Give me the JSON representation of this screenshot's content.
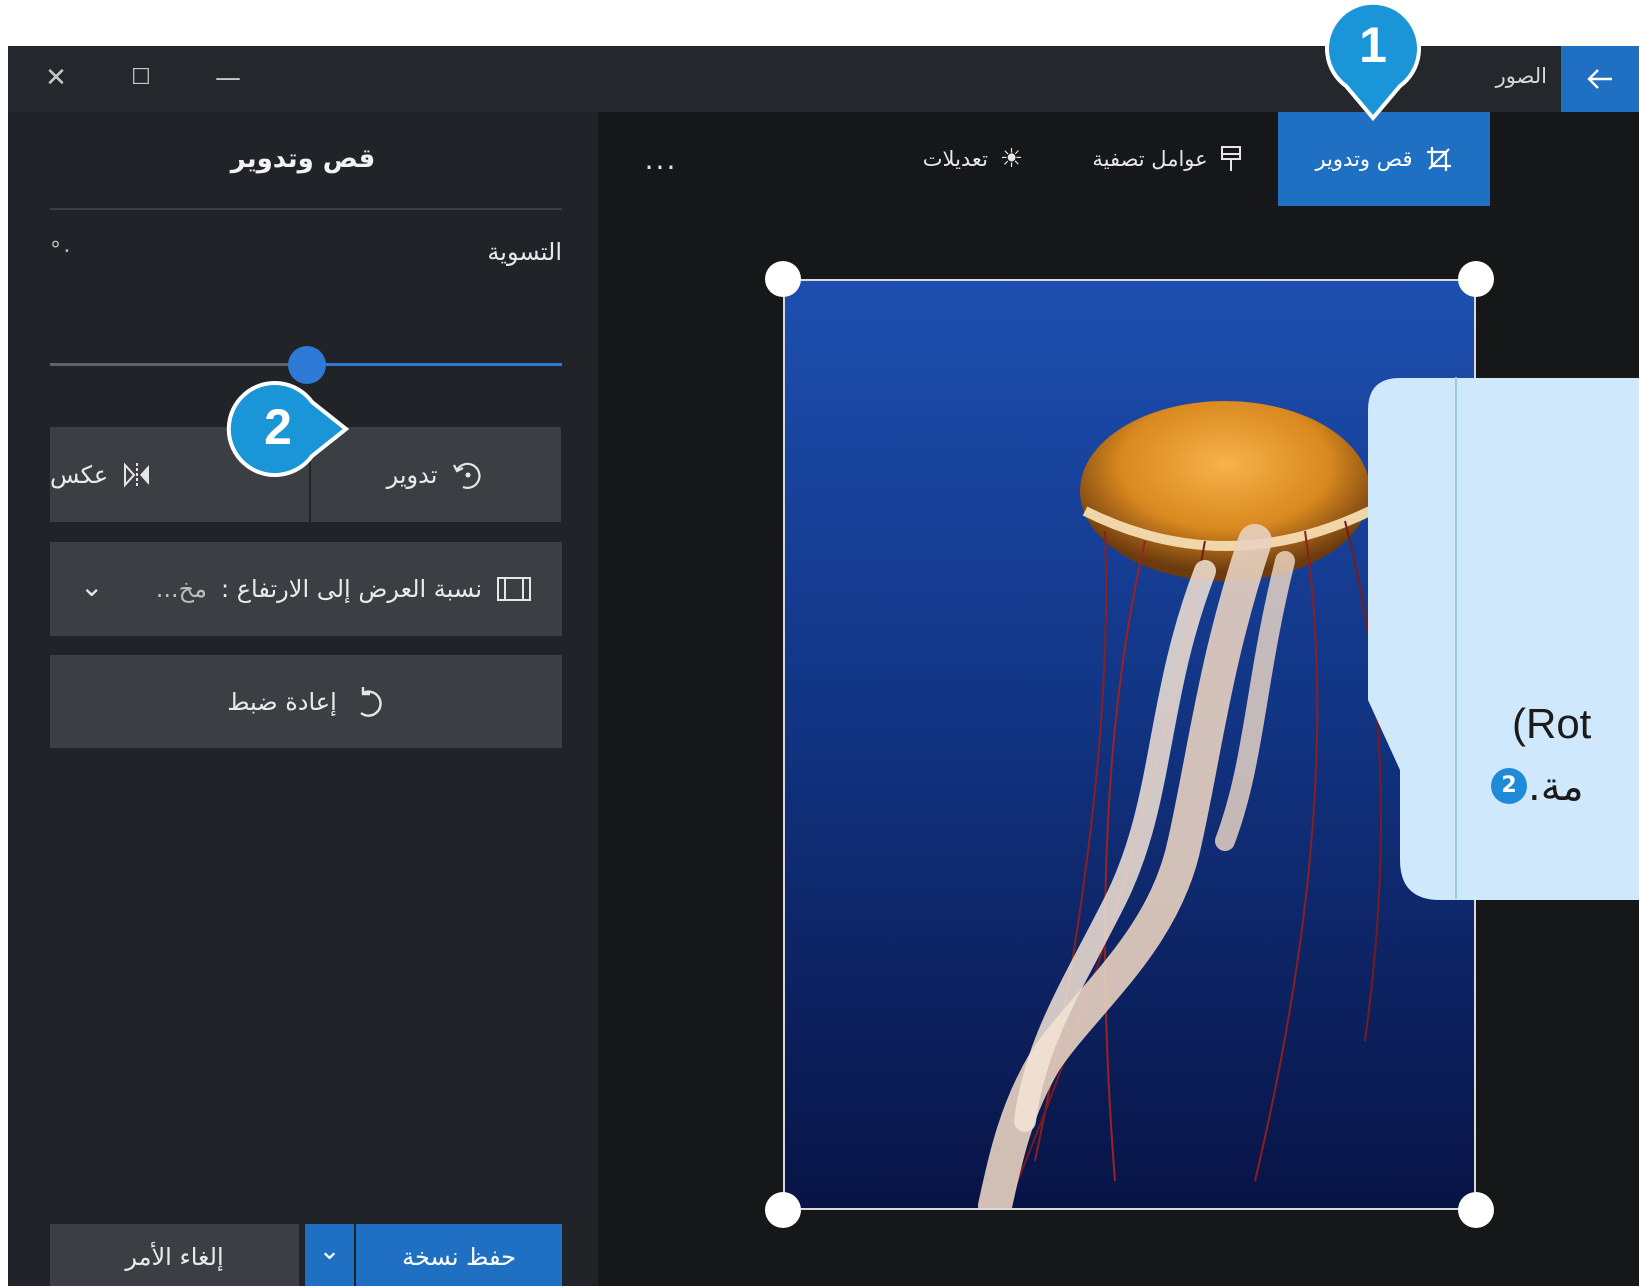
{
  "window": {
    "app_title": "الصور",
    "back_icon": "arrow-left-icon",
    "controls": {
      "close": "✕",
      "maximize": "☐",
      "minimize": "—"
    }
  },
  "toolbar": {
    "crop_rotate": "قص وتدوير",
    "filters": "عوامل تصفية",
    "adjustments": "تعديلات",
    "more": "..."
  },
  "panel": {
    "title": "قص وتدوير",
    "straighten_label": "التسوية",
    "straighten_value": "°٠",
    "straighten_level": 0.5,
    "rotate": "تدوير",
    "flip": "عكس",
    "aspect_ratio_label": "نسبة العرض إلى الارتفاع :",
    "aspect_ratio_value": "مخ...",
    "reset": "إعادة ضبط",
    "save_copy": "حفظ نسخة",
    "cancel": "إلغاء الأمر"
  },
  "callout": {
    "line1": "(Rot",
    "line2": "مة.",
    "badge": "2"
  },
  "markers": [
    {
      "label": "1"
    },
    {
      "label": "2"
    }
  ],
  "colors": {
    "accent": "#1f6fc2",
    "marker": "#1a95d8",
    "callout_bg": "#cfe8fb"
  }
}
